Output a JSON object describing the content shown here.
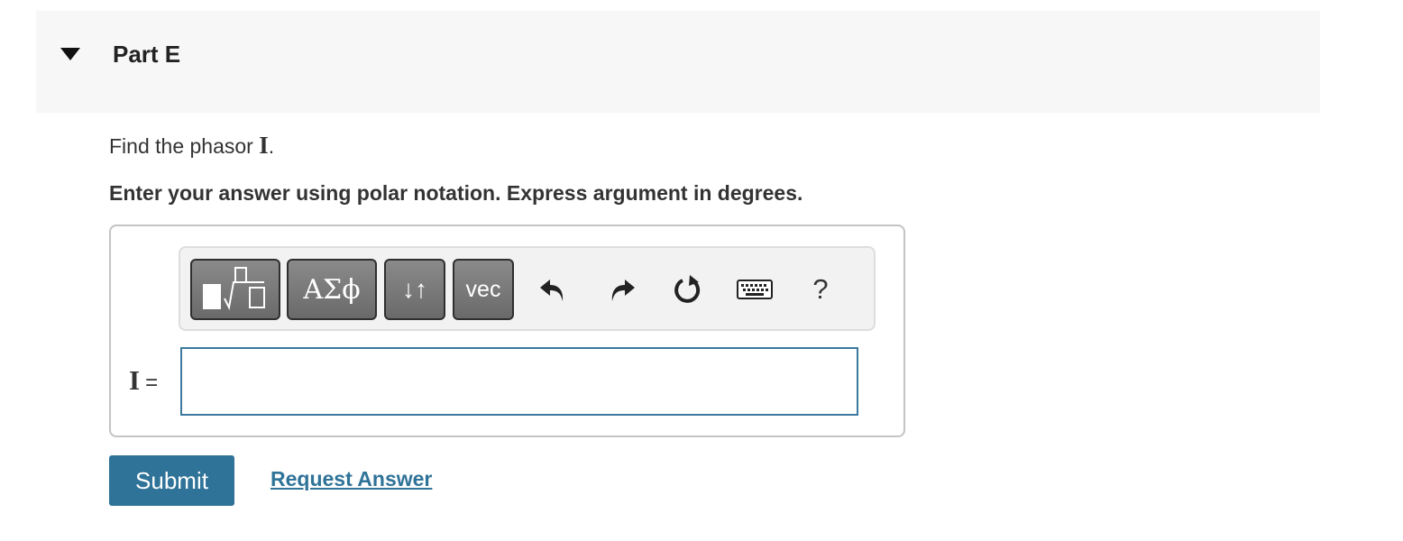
{
  "part": {
    "title": "Part E",
    "expanded": true
  },
  "question": {
    "prefix": "Find the phasor ",
    "symbol": "I",
    "suffix": "."
  },
  "instruction": "Enter your answer using polar notation. Express argument in degrees.",
  "toolbar": {
    "templates_icon": "templates-icon",
    "greek_label": "ΑΣϕ",
    "arrows_label": "↓↑",
    "vec_label": "vec",
    "undo_icon": "undo-icon",
    "redo_icon": "redo-icon",
    "reset_icon": "reset-icon",
    "keyboard_icon": "keyboard-icon",
    "help_label": "?"
  },
  "answer": {
    "symbol": "I",
    "equals": "=",
    "value": ""
  },
  "actions": {
    "submit_label": "Submit",
    "request_answer_label": "Request Answer"
  },
  "colors": {
    "header_bg": "#f7f7f7",
    "accent": "#2f7399",
    "input_border": "#3b7a9e",
    "toolbar_button": "#7a7a7a"
  }
}
